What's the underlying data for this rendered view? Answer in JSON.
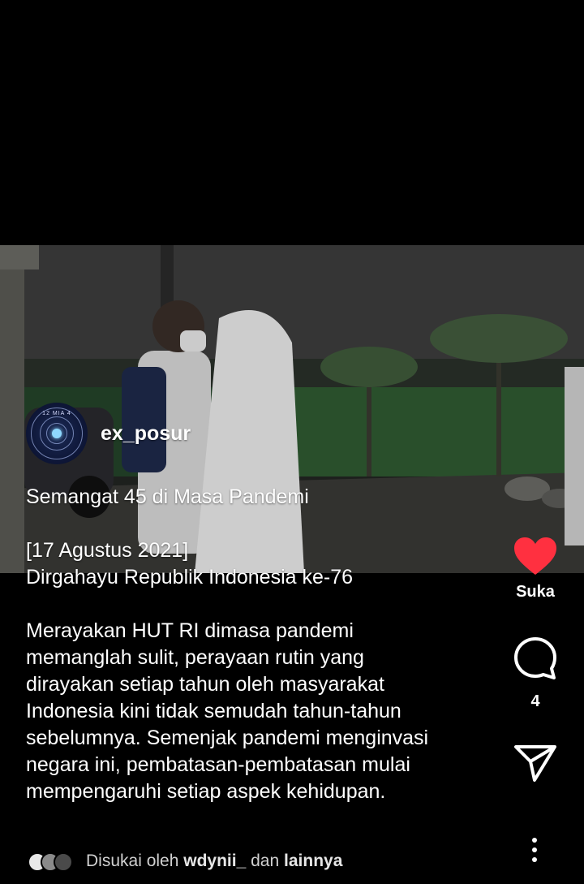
{
  "post": {
    "username": "ex_posur",
    "avatar_label": "12 MIA 4",
    "caption": {
      "title": "Semangat 45 di Masa Pandemi",
      "date_line": "[17 Agustus 2021]",
      "subtitle": "Dirgahayu Republik Indonesia ke-76",
      "body_lines": [
        "Merayakan HUT RI dimasa pandemi",
        "memanglah sulit, perayaan rutin yang",
        "dirayakan setiap tahun oleh masyarakat",
        "Indonesia kini tidak semudah tahun-tahun",
        "sebelumnya. Semenjak pandemi menginvasi",
        "negara ini, pembatasan-pembatasan mulai",
        "mempengaruhi setiap aspek kehidupan."
      ]
    }
  },
  "actions": {
    "like_label": "Suka",
    "like_color": "#ff3040",
    "comment_count": "4",
    "icons": [
      "heart-icon",
      "comment-icon",
      "share-icon",
      "more-vertical-icon"
    ]
  },
  "liked_by": {
    "prefix": "Disukai oleh",
    "user": "wdynii_",
    "connector": "dan",
    "suffix": "lainnya"
  }
}
